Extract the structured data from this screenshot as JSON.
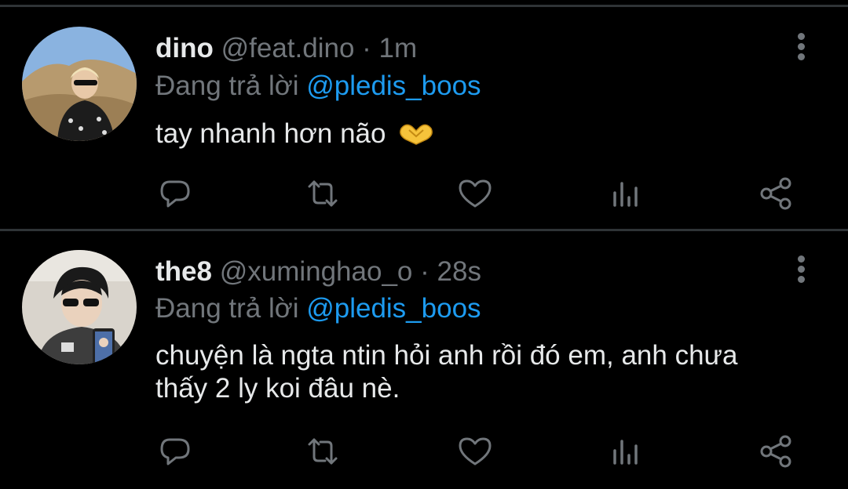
{
  "colors": {
    "background": "#000000",
    "divider": "#2f3336",
    "text": "#e7e9ea",
    "muted": "#71767b",
    "accent": "#1d9bf0"
  },
  "action_icons": [
    "reply-icon",
    "retweet-icon",
    "like-icon",
    "analytics-icon",
    "share-icon"
  ],
  "tweets": [
    {
      "name": "dino",
      "handle": "@feat.dino",
      "separator": "·",
      "time": "1m",
      "reply_prefix": "Đang trả lời",
      "reply_to": "@pledis_boos",
      "text_lines": [
        "tay nhanh hơn não"
      ],
      "emoji": "heart-hands-emoji"
    },
    {
      "name": "the8",
      "handle": "@xuminghao_o",
      "separator": "·",
      "time": "28s",
      "reply_prefix": "Đang trả lời",
      "reply_to": "@pledis_boos",
      "text_lines": [
        "chuyện là ngta ntin hỏi anh rồi đó em, anh chưa",
        "thấy 2 ly koi đâu nè."
      ]
    }
  ]
}
